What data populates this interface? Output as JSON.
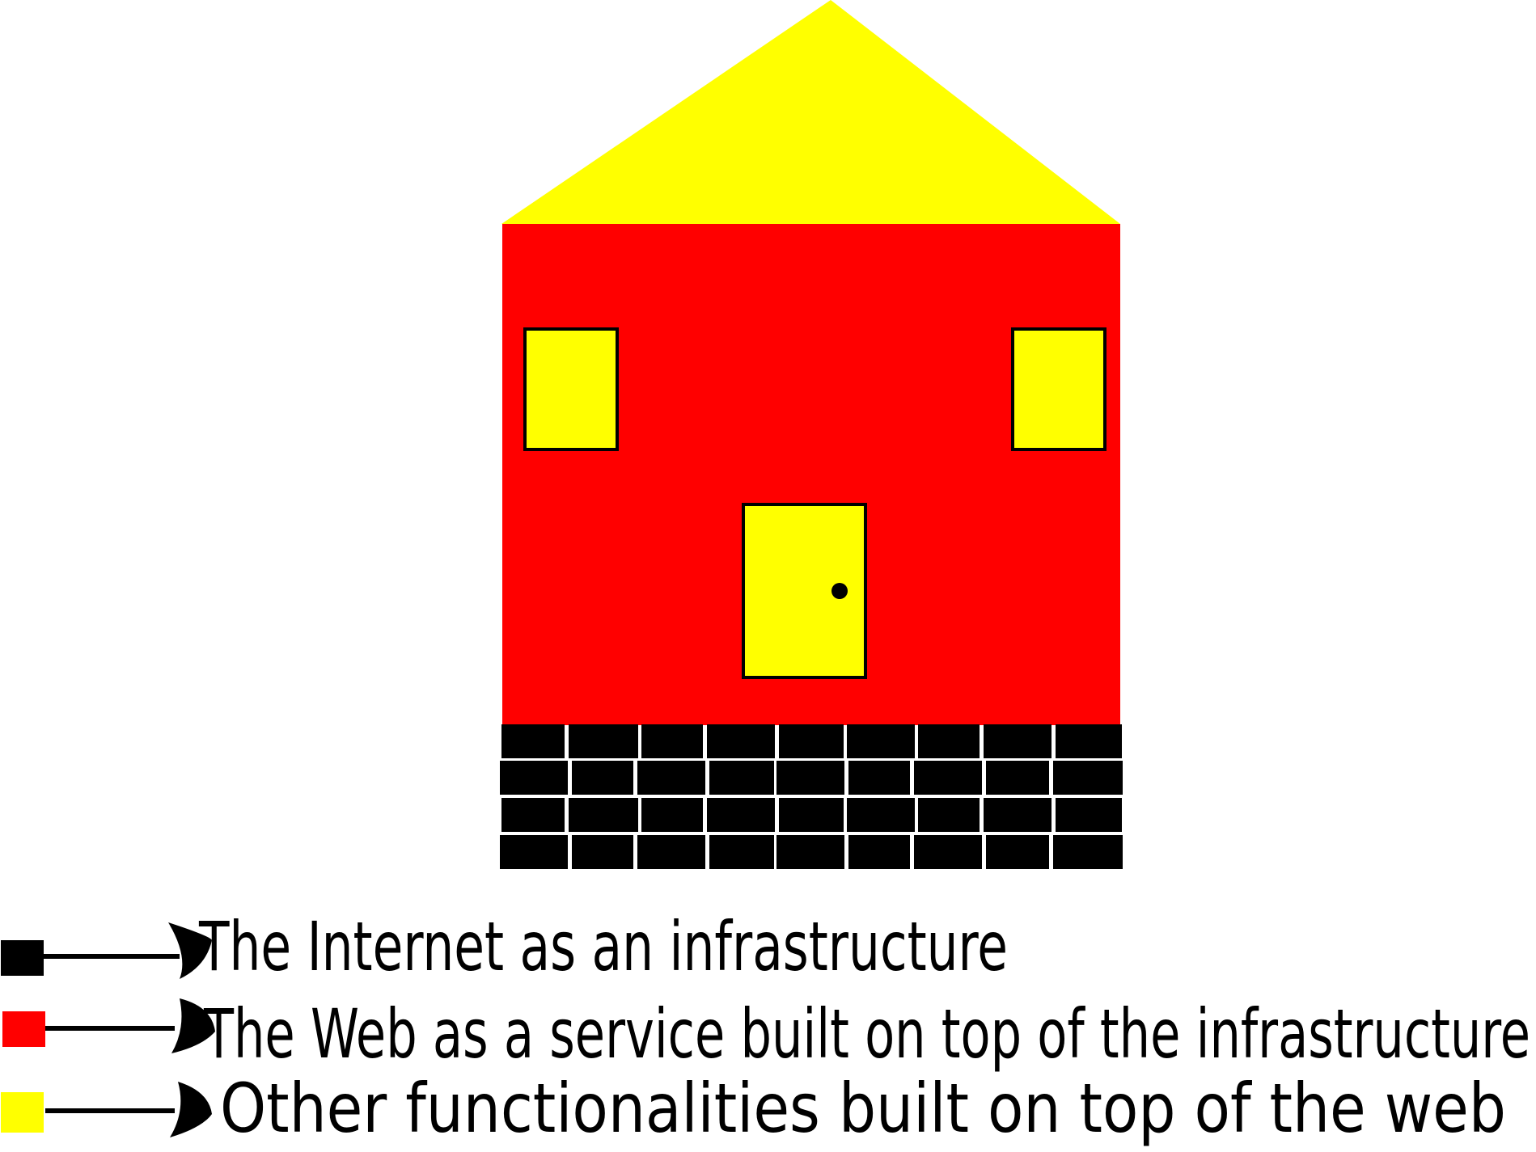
{
  "colors": {
    "background": "#ffffff",
    "internet": "#000000",
    "web": "#ff0000",
    "functionalities": "#ffff00",
    "outline": "#000000"
  },
  "house": {
    "roof_layer": "functionalities",
    "wall_layer": "web",
    "foundation_layer": "internet",
    "windows": 2,
    "door": 1,
    "brick_rows": 4
  },
  "legend": {
    "items": [
      {
        "key": "internet",
        "label": "The Internet as an infrastructure"
      },
      {
        "key": "web",
        "label": "The Web as a service built on top of the infrastructure"
      },
      {
        "key": "functionalities",
        "label": "Other functionalities built on top of the web"
      }
    ]
  }
}
